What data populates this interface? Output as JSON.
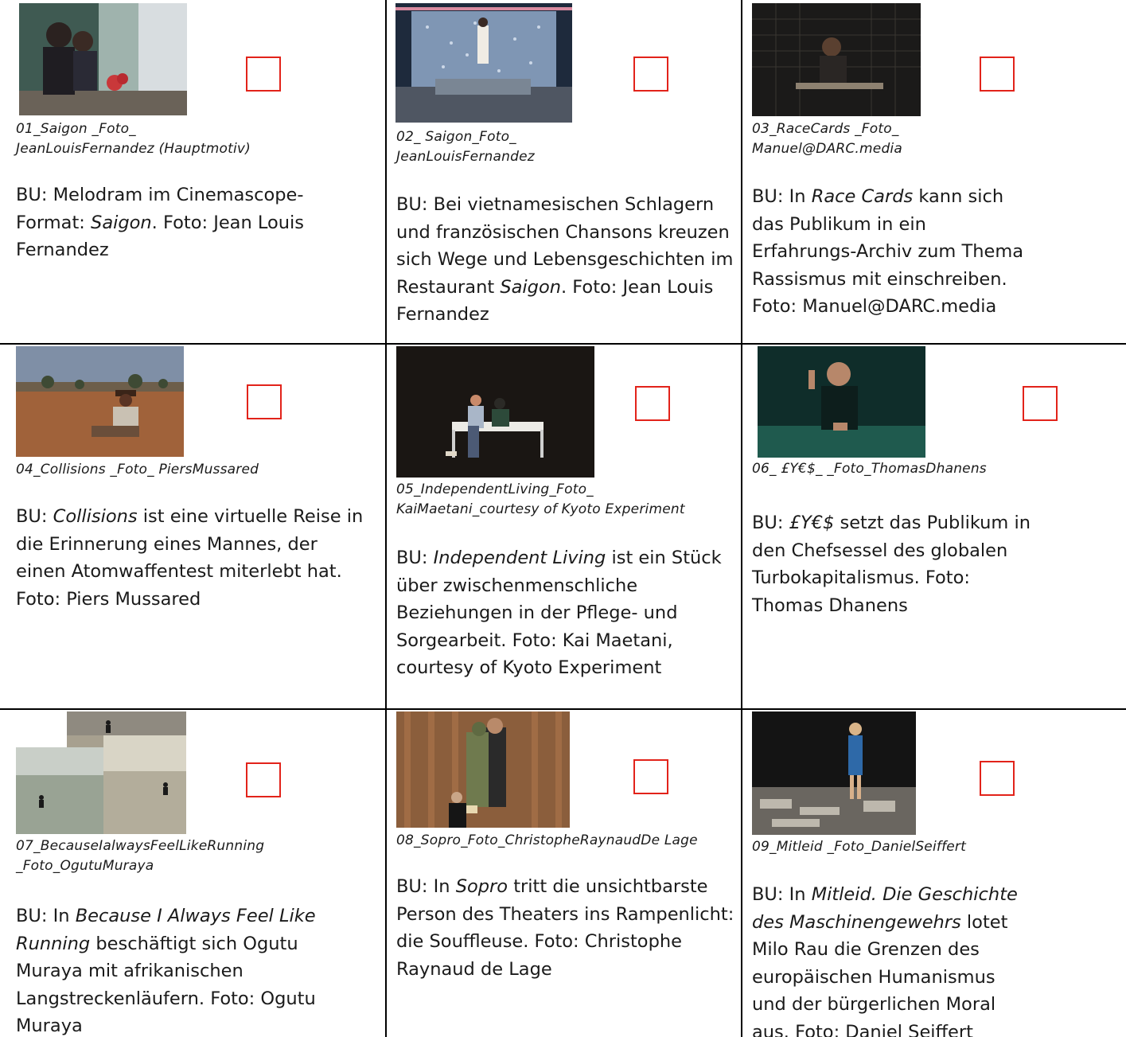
{
  "cells": [
    {
      "filename": "01_Saigon _Foto_\nJeanLouisFernandez (Hauptmotiv)",
      "caption_a": "BU: Melodram im Cinemascope-Format: ",
      "caption_i": "Saigon",
      "caption_b": ". Foto: Jean Louis Fernandez"
    },
    {
      "filename": "02_ Saigon_Foto_\nJeanLouisFernandez",
      "caption_a": "BU: Bei vietnamesischen Schlagern und französischen Chansons kreuzen sich Wege und Lebensgeschichten im Restaurant ",
      "caption_i": "Saigon",
      "caption_b": ". Foto: Jean Louis Fernandez"
    },
    {
      "filename": "03_RaceCards _Foto_\nManuel@DARC.media",
      "caption_a": " BU: In ",
      "caption_i": "Race Cards",
      "caption_b": " kann sich das Publikum in ein Erfahrungs-Archiv zum Thema Rassismus mit einschreiben. Foto: Manuel@DARC.media"
    },
    {
      "filename": "04_Collisions _Foto_ PiersMussared",
      "caption_a": "BU: ",
      "caption_i": "Collisions",
      "caption_b": " ist eine virtuelle Reise in die Erinnerung eines Mannes, der einen Atomwaffentest miterlebt hat. Foto: Piers Mussared"
    },
    {
      "filename": "05_IndependentLiving_Foto_\nKaiMaetani_courtesy of Kyoto Experiment",
      "caption_a": "BU: ",
      "caption_i": "Independent Living",
      "caption_b": " ist ein Stück über zwischenmenschliche Beziehungen in der Pflege- und Sorgearbeit. Foto: Kai Maetani, courtesy of Kyoto Experiment"
    },
    {
      "filename": "06_ £Y€$_ _Foto_ThomasDhanens",
      "caption_a": "BU: ",
      "caption_i": "£Y€$",
      "caption_b": " setzt das Publikum in den Chefsessel des globalen Turbokapitalismus. Foto: Thomas Dhanens"
    },
    {
      "filename": "07_BecauseIalwaysFeelLikeRunning\n_Foto_OgutuMuraya",
      "caption_a": "BU: In ",
      "caption_i": "Because I Always Feel Like Running",
      "caption_b": " beschäftigt sich Ogutu Muraya mit afrikanischen Langstreckenläufern. Foto: Ogutu Muraya"
    },
    {
      "filename": "08_Sopro_Foto_ChristopheRaynaudDe Lage",
      "caption_a": "BU: In ",
      "caption_i": "Sopro",
      "caption_b": " tritt die unsichtbarste Person des Theaters ins Rampenlicht: die Souffleuse. Foto: Christophe Raynaud de Lage"
    },
    {
      "filename": "09_Mitleid _Foto_DanielSeiffert",
      "caption_a": "BU: In ",
      "caption_i": "Mitleid. Die Geschichte des Maschinengewehrs",
      "caption_b": " lotet Milo Rau die Grenzen des europäischen Humanismus und der bürgerlichen Moral aus. Foto: Daniel Seiffert"
    }
  ],
  "colors": {
    "checkbox_border": "#e2231a",
    "grid": "#000000"
  }
}
